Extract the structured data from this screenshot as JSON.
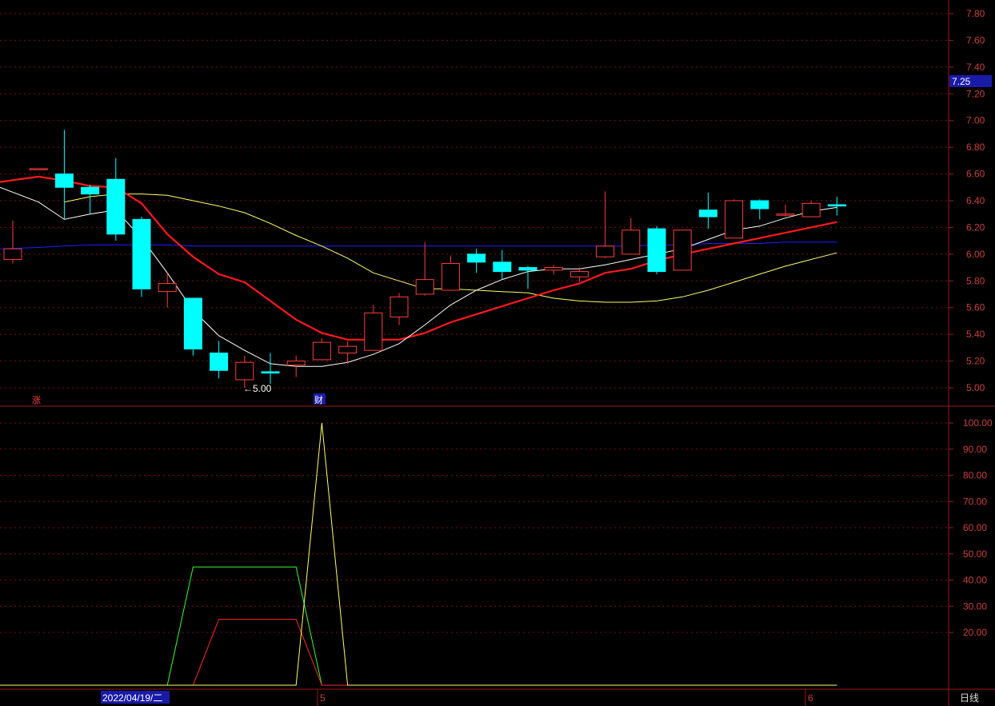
{
  "price_axis_ticks": [
    "7.80",
    "7.60",
    "7.40",
    "7.20",
    "7.00",
    "6.80",
    "6.60",
    "6.40",
    "6.20",
    "6.00",
    "5.80",
    "5.60",
    "5.40",
    "5.20",
    "5.00"
  ],
  "indicator_axis_ticks": [
    "100.00",
    "90.00",
    "80.00",
    "70.00",
    "60.00",
    "50.00",
    "40.00",
    "30.00",
    "20.00"
  ],
  "current_price_label": "7.25",
  "min_price_marker": "←5.00",
  "mark_zhang": "涨",
  "mark_cai": "财",
  "period_label": "日线",
  "x_labels": {
    "date": "2022/04/19/二",
    "month5": "5",
    "month6": "6"
  },
  "colors": {
    "up": "#ff3c3c",
    "down": "#00ffff",
    "ma5": "#ffffff",
    "ma10": "#ff1a1a",
    "ma20": "#ffff66",
    "ma60": "#2020ff",
    "grid": "#7a1010",
    "axis": "#a01818",
    "green_line": "#33ff33"
  },
  "chart_data": [
    {
      "type": "candlestick",
      "title": "",
      "ylim": [
        4.92,
        7.86
      ],
      "candles": [
        {
          "o": 5.96,
          "h": 6.25,
          "l": 5.93,
          "c": 6.04
        },
        {
          "o": 6.64,
          "h": 6.64,
          "l": 6.64,
          "c": 6.64
        },
        {
          "o": 6.6,
          "h": 6.93,
          "l": 6.26,
          "c": 6.5
        },
        {
          "o": 6.5,
          "h": 6.52,
          "l": 6.3,
          "c": 6.45
        },
        {
          "o": 6.56,
          "h": 6.72,
          "l": 6.1,
          "c": 6.15
        },
        {
          "o": 6.26,
          "h": 6.28,
          "l": 5.68,
          "c": 5.74
        },
        {
          "o": 5.72,
          "h": 5.86,
          "l": 5.6,
          "c": 5.78
        },
        {
          "o": 5.67,
          "h": 5.67,
          "l": 5.24,
          "c": 5.29
        },
        {
          "o": 5.26,
          "h": 5.35,
          "l": 5.07,
          "c": 5.13
        },
        {
          "o": 5.06,
          "h": 5.24,
          "l": 5.0,
          "c": 5.19
        },
        {
          "o": 5.12,
          "h": 5.26,
          "l": 5.03,
          "c": 5.11
        },
        {
          "o": 5.17,
          "h": 5.24,
          "l": 5.08,
          "c": 5.2
        },
        {
          "o": 5.21,
          "h": 5.37,
          "l": 5.21,
          "c": 5.34
        },
        {
          "o": 5.26,
          "h": 5.35,
          "l": 5.18,
          "c": 5.31
        },
        {
          "o": 5.28,
          "h": 5.62,
          "l": 5.28,
          "c": 5.56
        },
        {
          "o": 5.53,
          "h": 5.71,
          "l": 5.47,
          "c": 5.68
        },
        {
          "o": 5.7,
          "h": 6.09,
          "l": 5.69,
          "c": 5.81
        },
        {
          "o": 5.73,
          "h": 5.99,
          "l": 5.73,
          "c": 5.93
        },
        {
          "o": 6.0,
          "h": 6.04,
          "l": 5.86,
          "c": 5.94
        },
        {
          "o": 5.94,
          "h": 6.03,
          "l": 5.81,
          "c": 5.87
        },
        {
          "o": 5.9,
          "h": 5.91,
          "l": 5.74,
          "c": 5.88
        },
        {
          "o": 5.88,
          "h": 5.92,
          "l": 5.85,
          "c": 5.9
        },
        {
          "o": 5.83,
          "h": 5.9,
          "l": 5.79,
          "c": 5.87
        },
        {
          "o": 5.98,
          "h": 6.47,
          "l": 5.97,
          "c": 6.06
        },
        {
          "o": 6.0,
          "h": 6.27,
          "l": 6.0,
          "c": 6.18
        },
        {
          "o": 6.19,
          "h": 6.21,
          "l": 5.85,
          "c": 5.87
        },
        {
          "o": 5.88,
          "h": 6.18,
          "l": 5.88,
          "c": 6.18
        },
        {
          "o": 6.33,
          "h": 6.46,
          "l": 6.19,
          "c": 6.28
        },
        {
          "o": 6.12,
          "h": 6.41,
          "l": 6.12,
          "c": 6.4
        },
        {
          "o": 6.4,
          "h": 6.41,
          "l": 6.26,
          "c": 6.34
        },
        {
          "o": 6.3,
          "h": 6.37,
          "l": 6.28,
          "c": 6.3
        },
        {
          "o": 6.28,
          "h": 6.4,
          "l": 6.28,
          "c": 6.38
        },
        {
          "o": 6.37,
          "h": 6.43,
          "l": 6.29,
          "c": 6.36
        }
      ],
      "ma5": [
        6.5,
        6.39,
        6.26,
        6.3,
        6.33,
        6.12,
        5.86,
        5.58,
        5.39,
        5.28,
        5.18,
        5.16,
        5.16,
        5.19,
        5.25,
        5.33,
        5.47,
        5.62,
        5.73,
        5.81,
        5.87,
        5.89,
        5.89,
        5.92,
        5.96,
        6.0,
        6.04,
        6.11,
        6.18,
        6.21,
        6.27,
        6.32,
        6.35
      ],
      "ma10": [
        6.54,
        6.58,
        6.55,
        6.51,
        6.5,
        6.38,
        6.15,
        5.98,
        5.85,
        5.79,
        5.65,
        5.51,
        5.41,
        5.36,
        5.36,
        5.36,
        5.41,
        5.49,
        5.55,
        5.61,
        5.67,
        5.73,
        5.78,
        5.86,
        5.89,
        5.95,
        6.0,
        6.04,
        6.08,
        6.12,
        6.16,
        6.2,
        6.24
      ],
      "ma20": [
        6.39,
        6.43,
        6.45,
        6.45,
        6.44,
        6.4,
        6.36,
        6.31,
        6.23,
        6.14,
        6.06,
        5.97,
        5.86,
        5.8,
        5.74,
        5.74,
        5.73,
        5.72,
        5.71,
        5.67,
        5.65,
        5.64,
        5.64,
        5.65,
        5.68,
        5.73,
        5.79,
        5.85,
        5.91,
        5.96,
        6.01
      ],
      "ma60": [
        6.04,
        6.05,
        6.06,
        6.07,
        6.07,
        6.07,
        6.07,
        6.06,
        6.06,
        6.06,
        6.06,
        6.06,
        6.06,
        6.06,
        6.06,
        6.06,
        6.06,
        6.06,
        6.06,
        6.06,
        6.06,
        6.06,
        6.06,
        6.06,
        6.06,
        6.07,
        6.07,
        6.08,
        6.08,
        6.08,
        6.09,
        6.09,
        6.09
      ]
    },
    {
      "type": "line",
      "title": "",
      "ylim": [
        0,
        100
      ],
      "series": [
        {
          "color": "#33ff33",
          "values": [
            0,
            0,
            0,
            0,
            0,
            0,
            0,
            45,
            45,
            45,
            45,
            45,
            0,
            0,
            0,
            0,
            0,
            0,
            0,
            0,
            0,
            0,
            0,
            0,
            0,
            0,
            0,
            0,
            0,
            0,
            0,
            0,
            0
          ]
        },
        {
          "color": "#ff2a2a",
          "values": [
            0,
            0,
            0,
            0,
            0,
            0,
            0,
            0,
            25,
            25,
            25,
            25,
            0,
            0,
            0,
            0,
            0,
            0,
            0,
            0,
            0,
            0,
            0,
            0,
            0,
            0,
            0,
            0,
            0,
            0,
            0,
            0,
            0
          ]
        },
        {
          "color": "#ffff66",
          "values": [
            0,
            0,
            0,
            0,
            0,
            0,
            0,
            0,
            0,
            0,
            0,
            0,
            100,
            0,
            0,
            0,
            0,
            0,
            0,
            0,
            0,
            0,
            0,
            0,
            0,
            0,
            0,
            0,
            0,
            0,
            0,
            0,
            0
          ]
        }
      ]
    }
  ]
}
